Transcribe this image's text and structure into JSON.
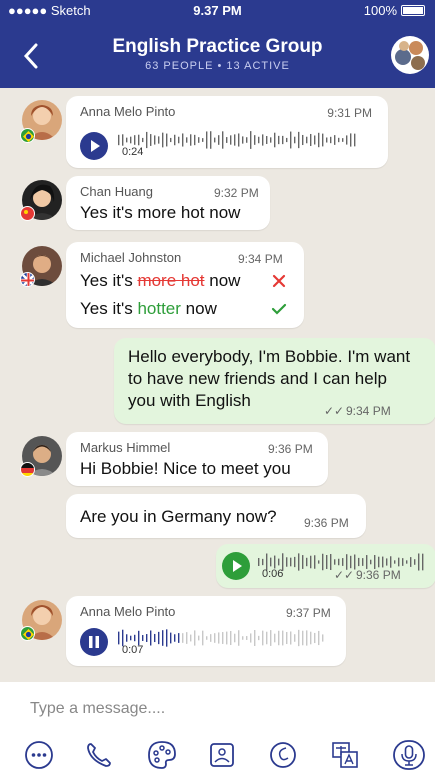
{
  "status_bar": {
    "carrier": "●●●●● Sketch",
    "time": "9.37 PM",
    "battery": "100%"
  },
  "header": {
    "title": "English Practice Group",
    "subtitle": "63 PEOPLE • 13 ACTIVE"
  },
  "messages": [
    {
      "sender": "Anna Melo Pinto",
      "time": "9:31 PM",
      "voice_duration": "0:24"
    },
    {
      "sender": "Chan Huang",
      "time": "9:32 PM",
      "text": "Yes it's more hot now"
    },
    {
      "sender": "Michael Johnston",
      "time": "9:34 PM",
      "wrong": {
        "prefix": "Yes it's",
        "strike": "more hot",
        "suffix": "now"
      },
      "right": {
        "prefix": "Yes it's",
        "highlight": "hotter",
        "suffix": "now"
      }
    },
    {
      "text": "Hello everybody, I'm Bobbie. I'm want to have new friends and I can help you with English",
      "time": "9:34 PM"
    },
    {
      "sender": "Markus Himmel",
      "time": "9:36 PM",
      "text": "Hi Bobbie! Nice to meet you"
    },
    {
      "text": "Are you in Germany now?",
      "time": "9:36 PM"
    },
    {
      "voice_duration": "0:06",
      "time": "9:36 PM"
    },
    {
      "sender": "Anna Melo Pinto",
      "time": "9:37 PM",
      "voice_duration": "0:07"
    }
  ],
  "input": {
    "placeholder": "Type a message...."
  },
  "colors": {
    "header": "#2b3a8f",
    "accent": "#2e9e3a",
    "error": "#e53935"
  }
}
